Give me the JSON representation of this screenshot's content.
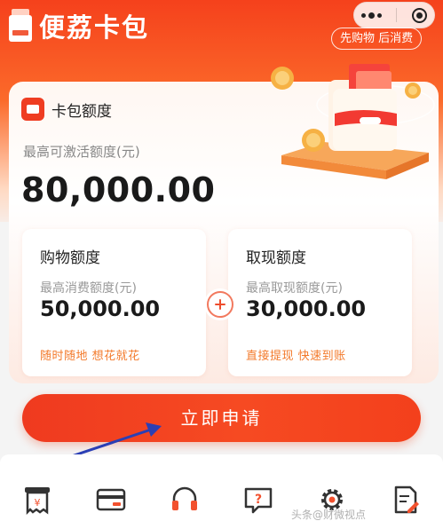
{
  "brand": {
    "name": "便荔卡包"
  },
  "tag": "先购物 后消费",
  "card": {
    "title": "卡包额度",
    "subtitle": "最高可激活额度(元)",
    "amount": "80,000.00"
  },
  "shopping": {
    "title": "购物额度",
    "label": "最高消费额度(元)",
    "value": "50,000.00",
    "slogan": "随时随地 想花就花"
  },
  "cash": {
    "title": "取现额度",
    "label": "最高取现额度(元)",
    "value": "30,000.00",
    "slogan": "直接提现 快速到账"
  },
  "apply_button": "立即申请",
  "bottom_nav_icons": [
    "receipt-yuan-icon",
    "card-icon",
    "headset-icon",
    "help-chat-icon",
    "gear-icon",
    "document-edit-icon"
  ],
  "watermark": "头条@财微视点",
  "colors": {
    "primary": "#f24422",
    "accent": "#f37a2b"
  }
}
